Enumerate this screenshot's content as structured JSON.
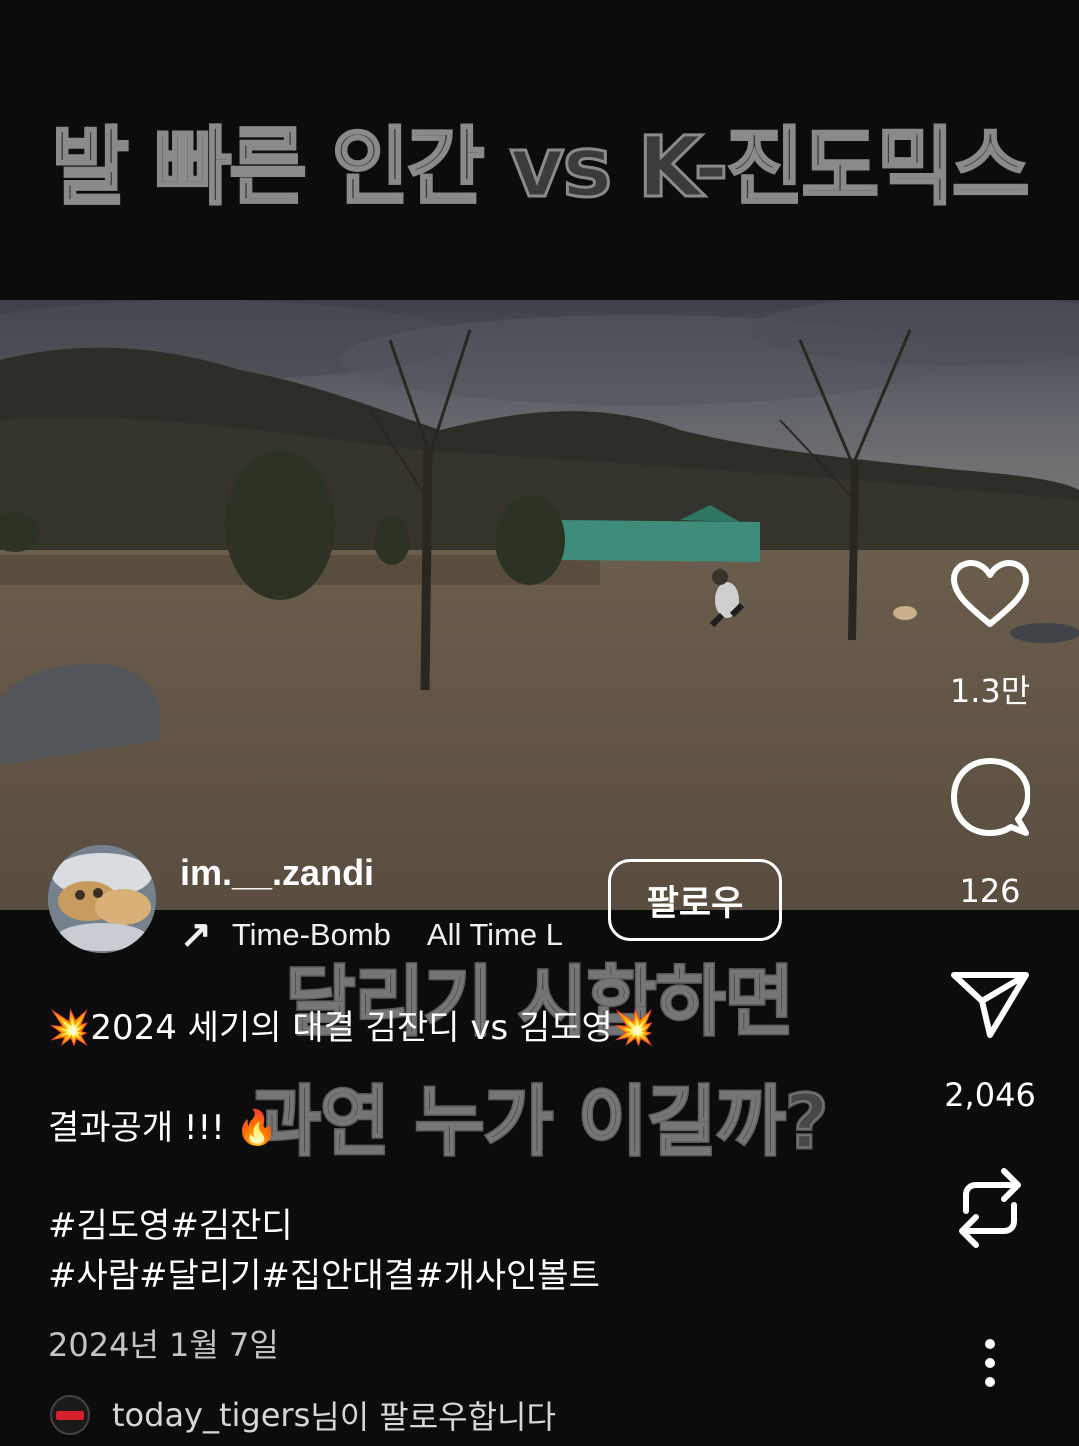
{
  "top_caption": "발 빠른 인간 vs K-진도믹스",
  "video": {
    "overlay_caption_line1": "달리기 시합하면",
    "overlay_caption_line2": "과연 누가 이길까?"
  },
  "author": {
    "username": "im.__.zandi",
    "music_arrow": "↗",
    "music_track_a": "Time-Bomb",
    "music_track_b": "All Time L"
  },
  "follow_button_label": "팔로우",
  "description": {
    "line1": "💥2024 세기의 대결 김잔디 vs 김도영💥",
    "line2": "결과공개 !!! 🔥",
    "hashtags_line1": "#김도영#김잔디",
    "hashtags_line2": "#사람#달리기#집안대결#개사인볼트"
  },
  "date": "2024년 1월 7일",
  "notification": {
    "user": "today_tigers",
    "text": "님이 팔로우합니다"
  },
  "actions": {
    "like_count": "1.3만",
    "comment_count": "126",
    "share_count": "2,046"
  },
  "icons": {
    "like": "heart-icon",
    "comment": "comment-bubble-icon",
    "share": "paper-plane-icon",
    "repost": "repost-icon",
    "more": "more-vertical-icon",
    "music": "music-arrow-icon"
  },
  "colors": {
    "background": "#0c0c0c",
    "text": "#ffffff",
    "muted_text": "#c4c4c4",
    "caption_gray": "#8a8a8a"
  }
}
